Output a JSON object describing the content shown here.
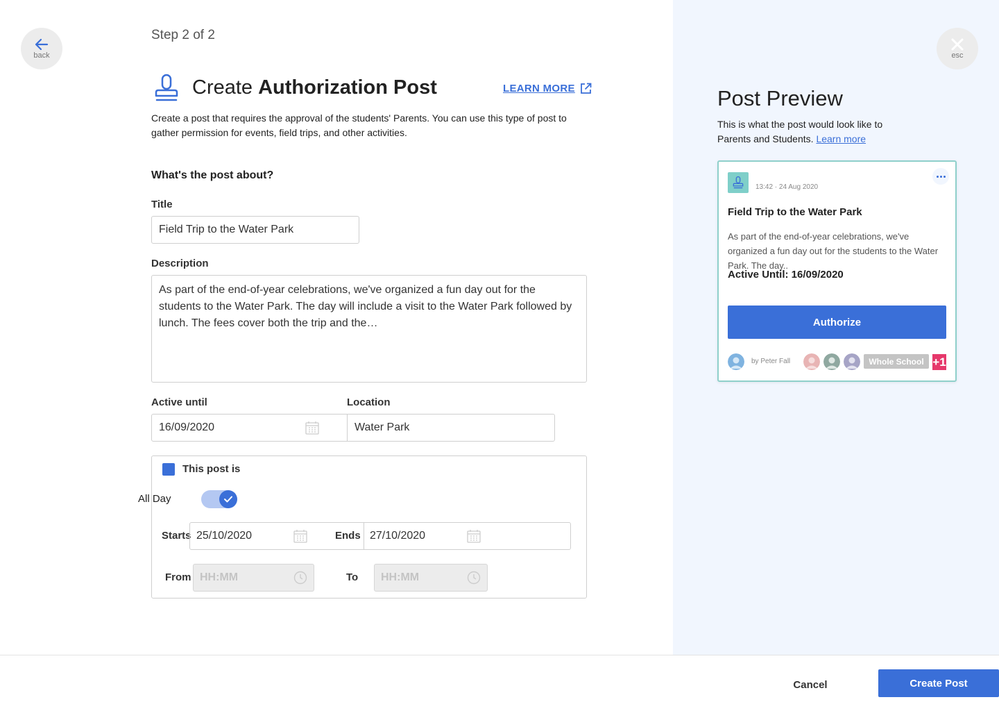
{
  "nav": {
    "back_label": "back",
    "esc_label": "esc"
  },
  "header": {
    "step": "Step 2 of 2",
    "title_prefix": "Create ",
    "title_bold": "Authorization Post",
    "learn_more": "LEARN MORE",
    "intro": "Create a post that requires the approval of the students' Parents. You can use this type of post to gather permission for events, field trips, and other activities."
  },
  "form": {
    "section_question": "What's the post about?",
    "title_label": "Title",
    "title_value": "Field Trip to the Water Park",
    "description_label": "Description",
    "description_value": "As part of the end-of-year celebrations, we've organized a fun day out for the students to the Water Park. The day will include a visit to the Water Park followed by lunch. The fees cover both the trip and the…",
    "active_until_label": "Active until",
    "active_until_value": "16/09/2020",
    "location_label": "Location",
    "location_value": "Water Park",
    "this_post_is_label": "This post is",
    "all_day_label": "All Day",
    "all_day_enabled": true,
    "starts_label": "Starts",
    "starts_value": "25/10/2020",
    "ends_label": "Ends",
    "ends_value": "27/10/2020",
    "from_label": "From",
    "from_placeholder": "HH:MM",
    "to_label": "To",
    "to_placeholder": "HH:MM"
  },
  "preview": {
    "title": "Post Preview",
    "subtitle": "This is what the post would look like to Parents and Students.",
    "learn_more": "Learn more",
    "card": {
      "timestamp": "13:42 · 24 Aug 2020",
      "title": "Field Trip to the Water Park",
      "description": "As part of the end-of-year celebrations, we've organized a fun day out for the students to the Water Park. The day..",
      "active_until": "Active Until: 16/09/2020",
      "authorize_label": "Authorize",
      "author": "by Peter Fall",
      "audience_badge": "Whole School",
      "extra_count": "+1"
    }
  },
  "footer": {
    "cancel_label": "Cancel",
    "create_label": "Create Post"
  },
  "colors": {
    "accent": "#3a6fd8",
    "preview_bg": "#f1f6fe",
    "card_border": "#8fd0cb",
    "badge_pink": "#e6386b"
  }
}
